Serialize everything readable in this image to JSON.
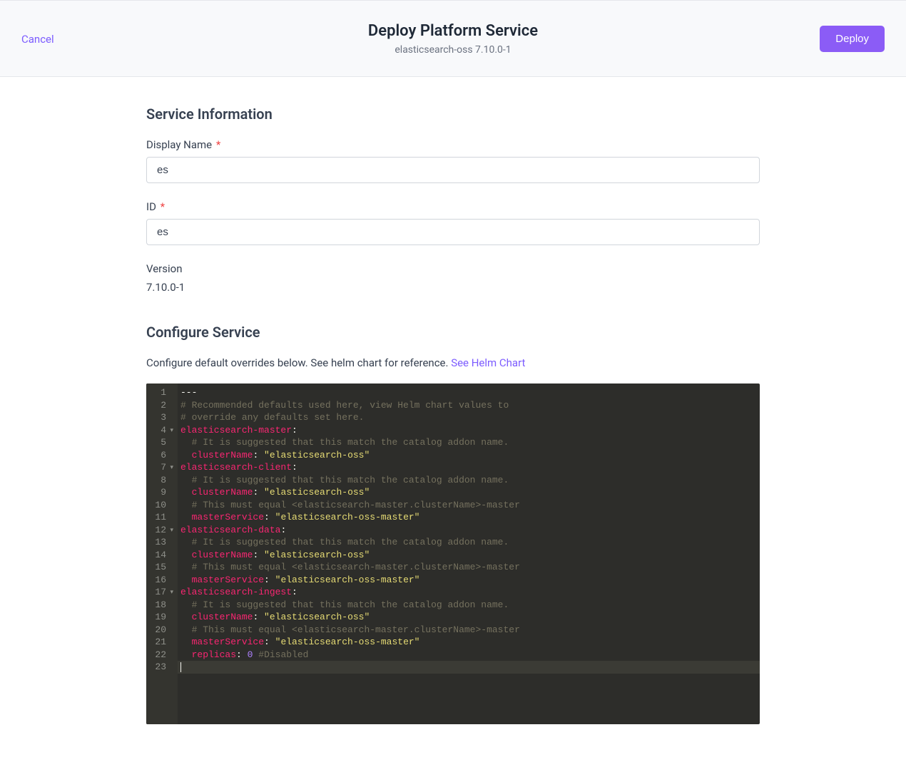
{
  "header": {
    "cancel_label": "Cancel",
    "title": "Deploy Platform Service",
    "subtitle": "elasticsearch-oss 7.10.0-1",
    "deploy_label": "Deploy"
  },
  "service_info": {
    "section_title": "Service Information",
    "display_name_label": "Display Name",
    "display_name_value": "es",
    "id_label": "ID",
    "id_value": "es",
    "version_label": "Version",
    "version_value": "7.10.0-1"
  },
  "configure": {
    "section_title": "Configure Service",
    "description": "Configure default overrides below. See helm chart for reference. ",
    "helm_link_label": "See Helm Chart"
  },
  "editor": {
    "lines": [
      {
        "n": 1,
        "fold": false,
        "tokens": [
          {
            "cls": "tok-plain",
            "t": "---"
          }
        ]
      },
      {
        "n": 2,
        "fold": false,
        "tokens": [
          {
            "cls": "tok-comment",
            "t": "# Recommended defaults used here, view Helm chart values to"
          }
        ]
      },
      {
        "n": 3,
        "fold": false,
        "tokens": [
          {
            "cls": "tok-comment",
            "t": "# override any defaults set here."
          }
        ]
      },
      {
        "n": 4,
        "fold": true,
        "tokens": [
          {
            "cls": "tok-key",
            "t": "elasticsearch-master"
          },
          {
            "cls": "tok-punct",
            "t": ":"
          }
        ]
      },
      {
        "n": 5,
        "fold": false,
        "tokens": [
          {
            "cls": "tok-plain",
            "t": "  "
          },
          {
            "cls": "tok-comment",
            "t": "# It is suggested that this match the catalog addon name."
          }
        ]
      },
      {
        "n": 6,
        "fold": false,
        "tokens": [
          {
            "cls": "tok-plain",
            "t": "  "
          },
          {
            "cls": "tok-key",
            "t": "clusterName"
          },
          {
            "cls": "tok-punct",
            "t": ": "
          },
          {
            "cls": "tok-string",
            "t": "\"elasticsearch-oss\""
          }
        ]
      },
      {
        "n": 7,
        "fold": true,
        "tokens": [
          {
            "cls": "tok-key",
            "t": "elasticsearch-client"
          },
          {
            "cls": "tok-punct",
            "t": ":"
          }
        ]
      },
      {
        "n": 8,
        "fold": false,
        "tokens": [
          {
            "cls": "tok-plain",
            "t": "  "
          },
          {
            "cls": "tok-comment",
            "t": "# It is suggested that this match the catalog addon name."
          }
        ]
      },
      {
        "n": 9,
        "fold": false,
        "tokens": [
          {
            "cls": "tok-plain",
            "t": "  "
          },
          {
            "cls": "tok-key",
            "t": "clusterName"
          },
          {
            "cls": "tok-punct",
            "t": ": "
          },
          {
            "cls": "tok-string",
            "t": "\"elasticsearch-oss\""
          }
        ]
      },
      {
        "n": 10,
        "fold": false,
        "tokens": [
          {
            "cls": "tok-plain",
            "t": "  "
          },
          {
            "cls": "tok-comment",
            "t": "# This must equal <elasticsearch-master.clusterName>-master"
          }
        ]
      },
      {
        "n": 11,
        "fold": false,
        "tokens": [
          {
            "cls": "tok-plain",
            "t": "  "
          },
          {
            "cls": "tok-key",
            "t": "masterService"
          },
          {
            "cls": "tok-punct",
            "t": ": "
          },
          {
            "cls": "tok-string",
            "t": "\"elasticsearch-oss-master\""
          }
        ]
      },
      {
        "n": 12,
        "fold": true,
        "tokens": [
          {
            "cls": "tok-key",
            "t": "elasticsearch-data"
          },
          {
            "cls": "tok-punct",
            "t": ":"
          }
        ]
      },
      {
        "n": 13,
        "fold": false,
        "tokens": [
          {
            "cls": "tok-plain",
            "t": "  "
          },
          {
            "cls": "tok-comment",
            "t": "# It is suggested that this match the catalog addon name."
          }
        ]
      },
      {
        "n": 14,
        "fold": false,
        "tokens": [
          {
            "cls": "tok-plain",
            "t": "  "
          },
          {
            "cls": "tok-key",
            "t": "clusterName"
          },
          {
            "cls": "tok-punct",
            "t": ": "
          },
          {
            "cls": "tok-string",
            "t": "\"elasticsearch-oss\""
          }
        ]
      },
      {
        "n": 15,
        "fold": false,
        "tokens": [
          {
            "cls": "tok-plain",
            "t": "  "
          },
          {
            "cls": "tok-comment",
            "t": "# This must equal <elasticsearch-master.clusterName>-master"
          }
        ]
      },
      {
        "n": 16,
        "fold": false,
        "tokens": [
          {
            "cls": "tok-plain",
            "t": "  "
          },
          {
            "cls": "tok-key",
            "t": "masterService"
          },
          {
            "cls": "tok-punct",
            "t": ": "
          },
          {
            "cls": "tok-string",
            "t": "\"elasticsearch-oss-master\""
          }
        ]
      },
      {
        "n": 17,
        "fold": true,
        "tokens": [
          {
            "cls": "tok-key",
            "t": "elasticsearch-ingest"
          },
          {
            "cls": "tok-punct",
            "t": ":"
          }
        ]
      },
      {
        "n": 18,
        "fold": false,
        "tokens": [
          {
            "cls": "tok-plain",
            "t": "  "
          },
          {
            "cls": "tok-comment",
            "t": "# It is suggested that this match the catalog addon name."
          }
        ]
      },
      {
        "n": 19,
        "fold": false,
        "tokens": [
          {
            "cls": "tok-plain",
            "t": "  "
          },
          {
            "cls": "tok-key",
            "t": "clusterName"
          },
          {
            "cls": "tok-punct",
            "t": ": "
          },
          {
            "cls": "tok-string",
            "t": "\"elasticsearch-oss\""
          }
        ]
      },
      {
        "n": 20,
        "fold": false,
        "tokens": [
          {
            "cls": "tok-plain",
            "t": "  "
          },
          {
            "cls": "tok-comment",
            "t": "# This must equal <elasticsearch-master.clusterName>-master"
          }
        ]
      },
      {
        "n": 21,
        "fold": false,
        "tokens": [
          {
            "cls": "tok-plain",
            "t": "  "
          },
          {
            "cls": "tok-key",
            "t": "masterService"
          },
          {
            "cls": "tok-punct",
            "t": ": "
          },
          {
            "cls": "tok-string",
            "t": "\"elasticsearch-oss-master\""
          }
        ]
      },
      {
        "n": 22,
        "fold": false,
        "tokens": [
          {
            "cls": "tok-plain",
            "t": "  "
          },
          {
            "cls": "tok-key",
            "t": "replicas"
          },
          {
            "cls": "tok-punct",
            "t": ": "
          },
          {
            "cls": "tok-number",
            "t": "0"
          },
          {
            "cls": "tok-plain",
            "t": " "
          },
          {
            "cls": "tok-comment",
            "t": "#Disabled"
          }
        ]
      },
      {
        "n": 23,
        "fold": false,
        "active": true,
        "tokens": []
      }
    ]
  }
}
